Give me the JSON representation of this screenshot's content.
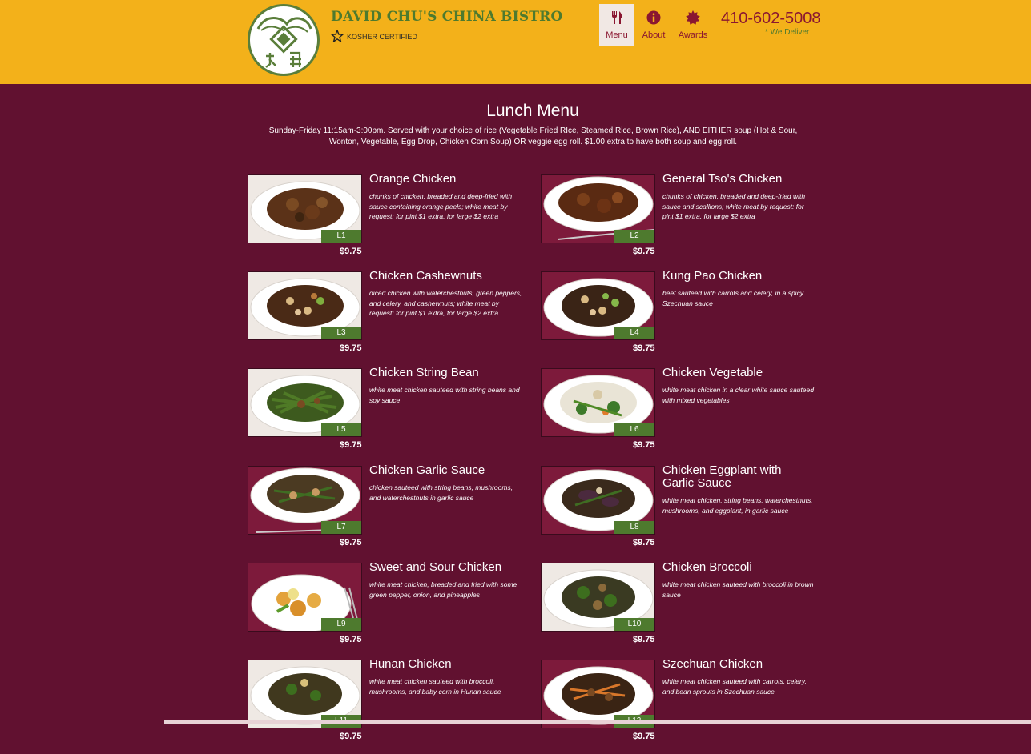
{
  "header": {
    "brand": "DAVID CHU'S CHINA BISTRO",
    "kosher": "KOSHER CERTIFIED",
    "phone": "410-602-5008",
    "deliver": "* We Deliver",
    "nav": [
      {
        "label": "Menu",
        "icon": "fork-knife-icon",
        "active": true
      },
      {
        "label": "About",
        "icon": "info-icon",
        "active": false
      },
      {
        "label": "Awards",
        "icon": "badge-icon",
        "active": false
      }
    ]
  },
  "menu": {
    "title": "Lunch Menu",
    "intro": "Sunday-Friday 11:15am-3:00pm. Served with your choice of rice (Vegetable Fried RIce, Steamed Rice, Brown Rice), AND EITHER soup (Hot & Sour, Wonton, Vegetable, Egg Drop, Chicken Corn Soup) OR veggie egg roll. $1.00 extra to have both soup and egg roll.",
    "items": [
      {
        "code": "L1",
        "name": "Orange Chicken",
        "desc": "chunks of chicken, breaded and deep-fried with sauce containing orange peels; white meat by request: for pint $1 extra, for large $2 extra",
        "price": "$9.75"
      },
      {
        "code": "L2",
        "name": "General Tso's Chicken",
        "desc": "chunks of chicken, breaded and deep-fried with sauce and scallions; white meat by request: for pint $1 extra, for large $2 extra",
        "price": "$9.75"
      },
      {
        "code": "L3",
        "name": "Chicken Cashewnuts",
        "desc": "diced chicken with waterchestnuts, green peppers, and celery, and cashewnuts; white meat by request: for pint $1 extra, for large $2 extra",
        "price": "$9.75"
      },
      {
        "code": "L4",
        "name": "Kung Pao Chicken",
        "desc": "beef sauteed with carrots and celery, in a spicy Szechuan sauce",
        "price": "$9.75"
      },
      {
        "code": "L5",
        "name": "Chicken String Bean",
        "desc": "white meat chicken sauteed with string beans and soy sauce",
        "price": "$9.75"
      },
      {
        "code": "L6",
        "name": "Chicken Vegetable",
        "desc": "white meat chicken in a clear white sauce sauteed with mixed vegetables",
        "price": "$9.75"
      },
      {
        "code": "L7",
        "name": "Chicken Garlic Sauce",
        "desc": "chicken sauteed with string beans, mushrooms, and waterchestnuts in garlic sauce",
        "price": "$9.75"
      },
      {
        "code": "L8",
        "name": "Chicken Eggplant with Garlic Sauce",
        "desc": "white meat chicken, string beans, waterchestnuts, mushrooms, and eggplant, in garlic sauce",
        "price": "$9.75"
      },
      {
        "code": "L9",
        "name": "Sweet and Sour Chicken",
        "desc": "white meat chicken, breaded and fried with some green pepper, onion, and pineapples",
        "price": "$9.75"
      },
      {
        "code": "L10",
        "name": "Chicken Broccoli",
        "desc": "white meat chicken sauteed with broccoli in brown sauce",
        "price": "$9.75"
      },
      {
        "code": "L11",
        "name": "Hunan Chicken",
        "desc": "white meat chicken sauteed with broccoli, mushrooms, and baby corn in Hunan sauce",
        "price": "$9.75"
      },
      {
        "code": "L12",
        "name": "Szechuan Chicken",
        "desc": "white meat chicken sauteed with carrots, celery, and bean sprouts in Szechuan sauce",
        "price": "$9.75"
      }
    ]
  },
  "colors": {
    "header_bg": "#f3b11a",
    "page_bg": "#611130",
    "accent_green": "#4e7a2e",
    "accent_red": "#8a1631"
  }
}
